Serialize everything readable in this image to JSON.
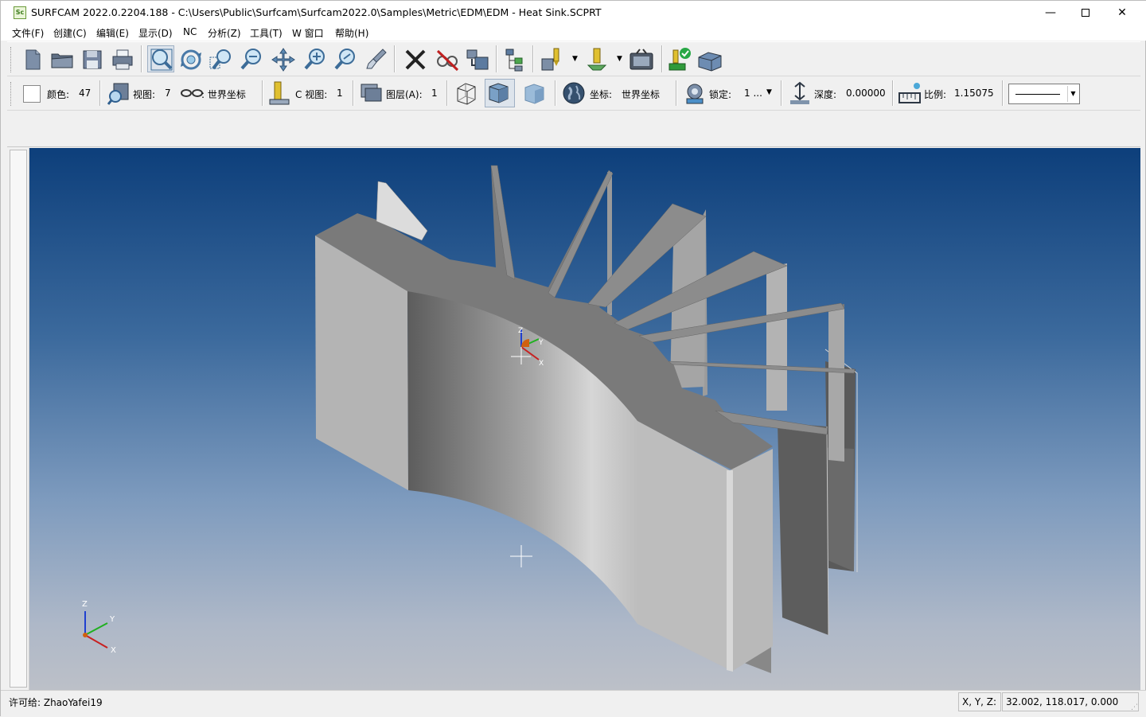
{
  "window": {
    "title": "SURFCAM 2022.0.2204.188 - C:\\Users\\Public\\Surfcam\\Surfcam2022.0\\Samples\\Metric\\EDM\\EDM - Heat Sink.SCPRT",
    "app_icon_text": "Sc",
    "min_glyph": "—",
    "close_glyph": "✕"
  },
  "menu": [
    {
      "label": "文件(F)"
    },
    {
      "label": "创建(C)"
    },
    {
      "label": "编辑(E)"
    },
    {
      "label": "显示(D)"
    },
    {
      "label": "NC"
    },
    {
      "label": "分析(Z)"
    },
    {
      "label": "工具(T)"
    },
    {
      "label": "W 窗口"
    },
    {
      "label": "帮助(H)"
    }
  ],
  "toolbar2": {
    "color_label": "颜色:",
    "color_value": "47",
    "view_label": "视图:",
    "view_value": "7",
    "view_coord": ": 世界坐标",
    "cview_label": "C 视图:",
    "cview_value": "1",
    "layer_label": "图层(A):",
    "layer_value": "1",
    "coord_label": "坐标:",
    "coord_value": "世界坐标",
    "lock_label": "锁定:",
    "lock_value": "1 ...",
    "depth_label": "深度:",
    "depth_value": "0.00000",
    "scale_label": "比例:",
    "scale_value": "1.15075"
  },
  "viewport": {
    "axis_labels": {
      "z": "Z",
      "y": "Y",
      "x": "X"
    },
    "colors": {
      "gradient_top": "#0d3f7b",
      "gradient_bottom": "#bcc0c8",
      "axis_x": "#c82020",
      "axis_y": "#20b020",
      "axis_z": "#2040d0",
      "origin": "#d06010"
    }
  },
  "status": {
    "license": "许可给: ZhaoYafei19",
    "coord_label": "X, Y, Z:",
    "coord_value": "32.002, 118.017, 0.000"
  }
}
